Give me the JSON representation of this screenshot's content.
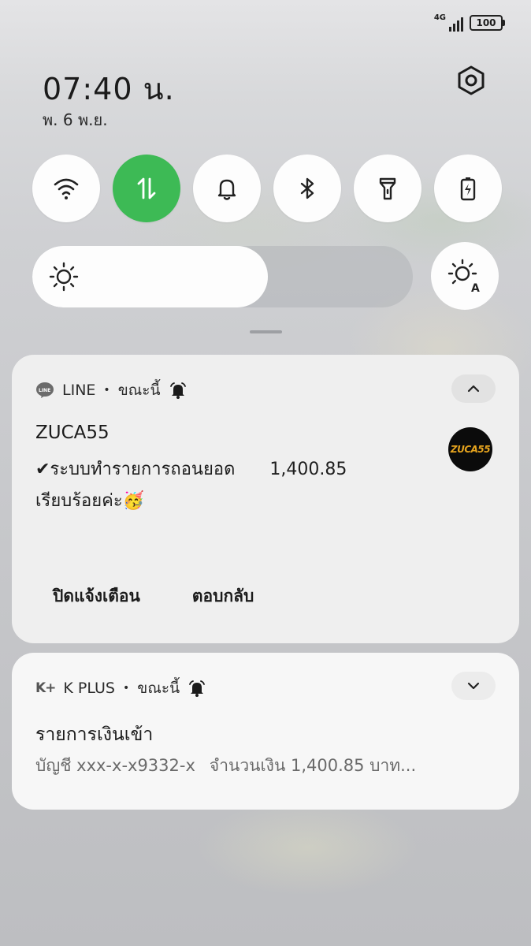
{
  "status_bar": {
    "network": "4G",
    "battery": "100"
  },
  "clock": {
    "time": "07:40 น.",
    "date": "พ. 6 พ.ย."
  },
  "quick_toggles": [
    {
      "name": "wifi",
      "icon": "wifi-icon",
      "active": false
    },
    {
      "name": "mobile-data",
      "icon": "data-transfer-icon",
      "active": true
    },
    {
      "name": "sound",
      "icon": "bell-icon",
      "active": false
    },
    {
      "name": "bluetooth",
      "icon": "bluetooth-icon",
      "active": false
    },
    {
      "name": "flashlight",
      "icon": "flashlight-icon",
      "active": false
    },
    {
      "name": "battery-saver",
      "icon": "battery-icon",
      "active": false
    }
  ],
  "brightness": {
    "level": 0.62,
    "auto_icon": "auto-brightness-icon"
  },
  "colors": {
    "toggle_active": "#3dba55",
    "card": "#efefef"
  },
  "notifications": [
    {
      "app": "LINE",
      "time": "ขณะนี้",
      "separator": "•",
      "title": "ZUCA55",
      "message_line1": "✔ระบบทำรายการถอนยอด",
      "amount": "1,400.85",
      "message_line2": "เรียบร้อยค่ะ🥳",
      "avatar_text": "ZUCA55",
      "actions": [
        "ปิดแจ้งเตือน",
        "ตอบกลับ"
      ]
    },
    {
      "app": "K PLUS",
      "app_logo": "K+",
      "time": "ขณะนี้",
      "separator": "•",
      "title": "รายการเงินเข้า",
      "account": "บัญชี xxx-x-x9332-x",
      "message": "จำนวนเงิน 1,400.85 บาท..."
    }
  ]
}
